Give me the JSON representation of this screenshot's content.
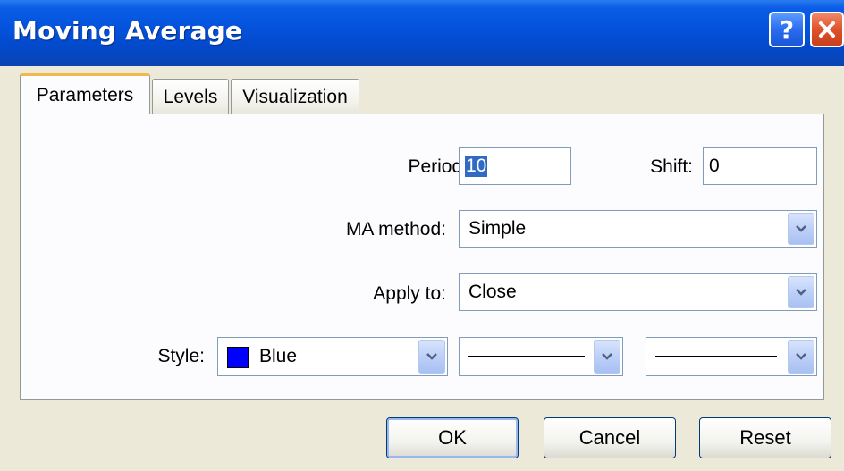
{
  "window": {
    "title": "Moving Average",
    "help_label": "?",
    "close_icon": "close-icon"
  },
  "tabs": [
    {
      "label": "Parameters",
      "active": true
    },
    {
      "label": "Levels",
      "active": false
    },
    {
      "label": "Visualization",
      "active": false
    }
  ],
  "parameters": {
    "period_label": "Period:",
    "period_value": "10",
    "shift_label": "Shift:",
    "shift_value": "0",
    "ma_method_label": "MA method:",
    "ma_method_value": "Simple",
    "apply_to_label": "Apply to:",
    "apply_to_value": "Close",
    "style_label": "Style:",
    "style_color_name": "Blue",
    "style_color_hex": "#0000ff",
    "line_style": "solid",
    "line_width": "thin"
  },
  "buttons": {
    "ok": "OK",
    "cancel": "Cancel",
    "reset": "Reset"
  },
  "colors": {
    "titlebar": "#0453dd",
    "dialog_bg": "#ece9d8",
    "active_tab_accent": "#f4b84a",
    "selection": "#316ac5"
  }
}
